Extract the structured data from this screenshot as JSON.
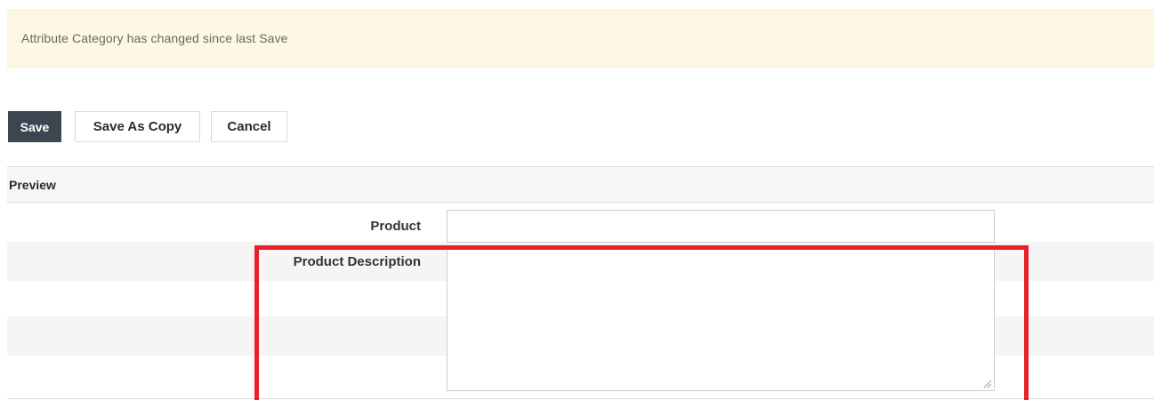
{
  "alert": {
    "message": "Attribute Category has changed since last Save",
    "background_color": "#fcf8e3"
  },
  "toolbar": {
    "save_label": "Save",
    "save_as_copy_label": "Save As Copy",
    "cancel_label": "Cancel",
    "save_color": "#3d4650"
  },
  "preview": {
    "title": "Preview",
    "fields": [
      {
        "label": "Product",
        "value": ""
      },
      {
        "label": "Product Description",
        "value": ""
      }
    ]
  },
  "annotation": {
    "highlight_color": "#e8202a"
  }
}
